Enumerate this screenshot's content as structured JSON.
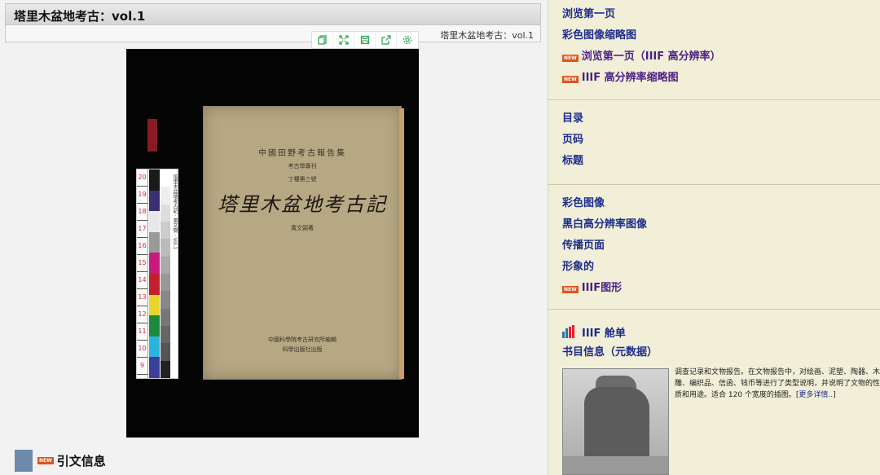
{
  "header": {
    "title": "塔里木盆地考古：vol.1",
    "subtitle": "塔里木盆地考古：vol.1"
  },
  "toolbar": {
    "tools": [
      "pages-icon",
      "fullscreen-icon",
      "save-icon",
      "share-icon",
      "settings-icon"
    ]
  },
  "book": {
    "series": "中國田野考古報告集",
    "series_sub": "考古學專刊",
    "series_num": "丁種第三號",
    "title": "塔里木盆地考古記",
    "author": "黃文弼著",
    "publisher_line1": "中國科學院考古研究所編輯",
    "publisher_line2": "科學出版社出版",
    "scale_label": "塔里木盆地考古記 · 黃文弼 · Vol.1",
    "ruler": [
      "20",
      "19",
      "18",
      "17",
      "16",
      "15",
      "14",
      "13",
      "12",
      "11",
      "10",
      "9"
    ]
  },
  "citation": {
    "label": "引文信息",
    "badge": "NEW"
  },
  "sidebar": {
    "section1": [
      {
        "label": "浏览第一页",
        "new": false
      },
      {
        "label": "彩色图像缩略图",
        "new": false
      },
      {
        "label": "浏览第一页（IIIF 高分辨率）",
        "new": true,
        "badge": "NEW"
      },
      {
        "label": "IIIF 高分辨率缩略图",
        "new": true,
        "badge": "NEW"
      }
    ],
    "section2": [
      {
        "label": "目录"
      },
      {
        "label": "页码"
      },
      {
        "label": "标题"
      }
    ],
    "section3": [
      {
        "label": "彩色图像",
        "new": false
      },
      {
        "label": "黑白高分辨率图像",
        "new": false
      },
      {
        "label": "传播页面",
        "new": false
      },
      {
        "label": "形象的",
        "new": false
      },
      {
        "label": "IIIF图形",
        "new": true,
        "badge": "NEW"
      }
    ],
    "iiif_manifest": "IIIF 舱单",
    "bibliography": "书目信息（元数据）",
    "description": "调查记录和文物报告。在文物报告中，对绘画、泥塑、陶器、木雕、编织品、信函、钱币等进行了类型说明，并说明了文物的性质和用途。适合 120 个宽度的插图。[",
    "more_link": "更多详情..",
    "desc_end": "]"
  },
  "colors": {
    "link": "#1d2c8d",
    "link_new": "#4b1f86",
    "sidebar_bg": "#f1efd7",
    "badge": "#e0541b"
  }
}
